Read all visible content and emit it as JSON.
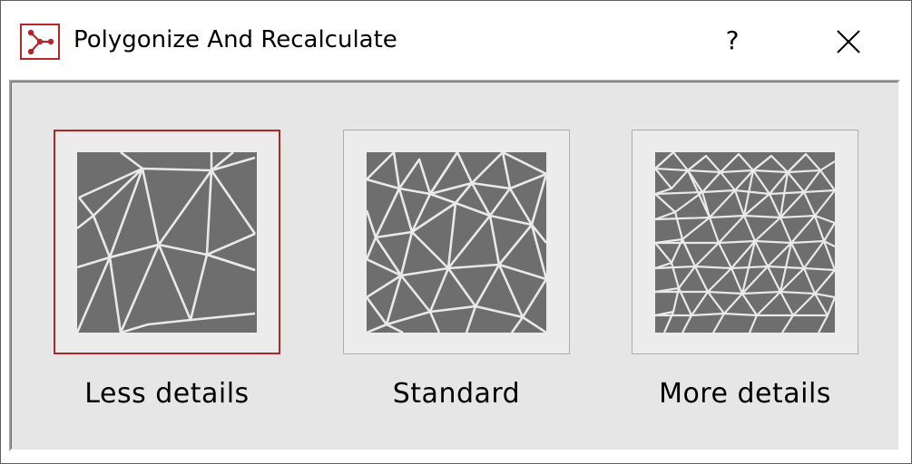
{
  "window": {
    "title": "Polygonize And Recalculate",
    "help_label": "?",
    "accent_color": "#b3262a"
  },
  "options": [
    {
      "label": "Less details",
      "selected": true,
      "mesh": "coarse"
    },
    {
      "label": "Standard",
      "selected": false,
      "mesh": "medium"
    },
    {
      "label": "More details",
      "selected": false,
      "mesh": "fine"
    }
  ]
}
